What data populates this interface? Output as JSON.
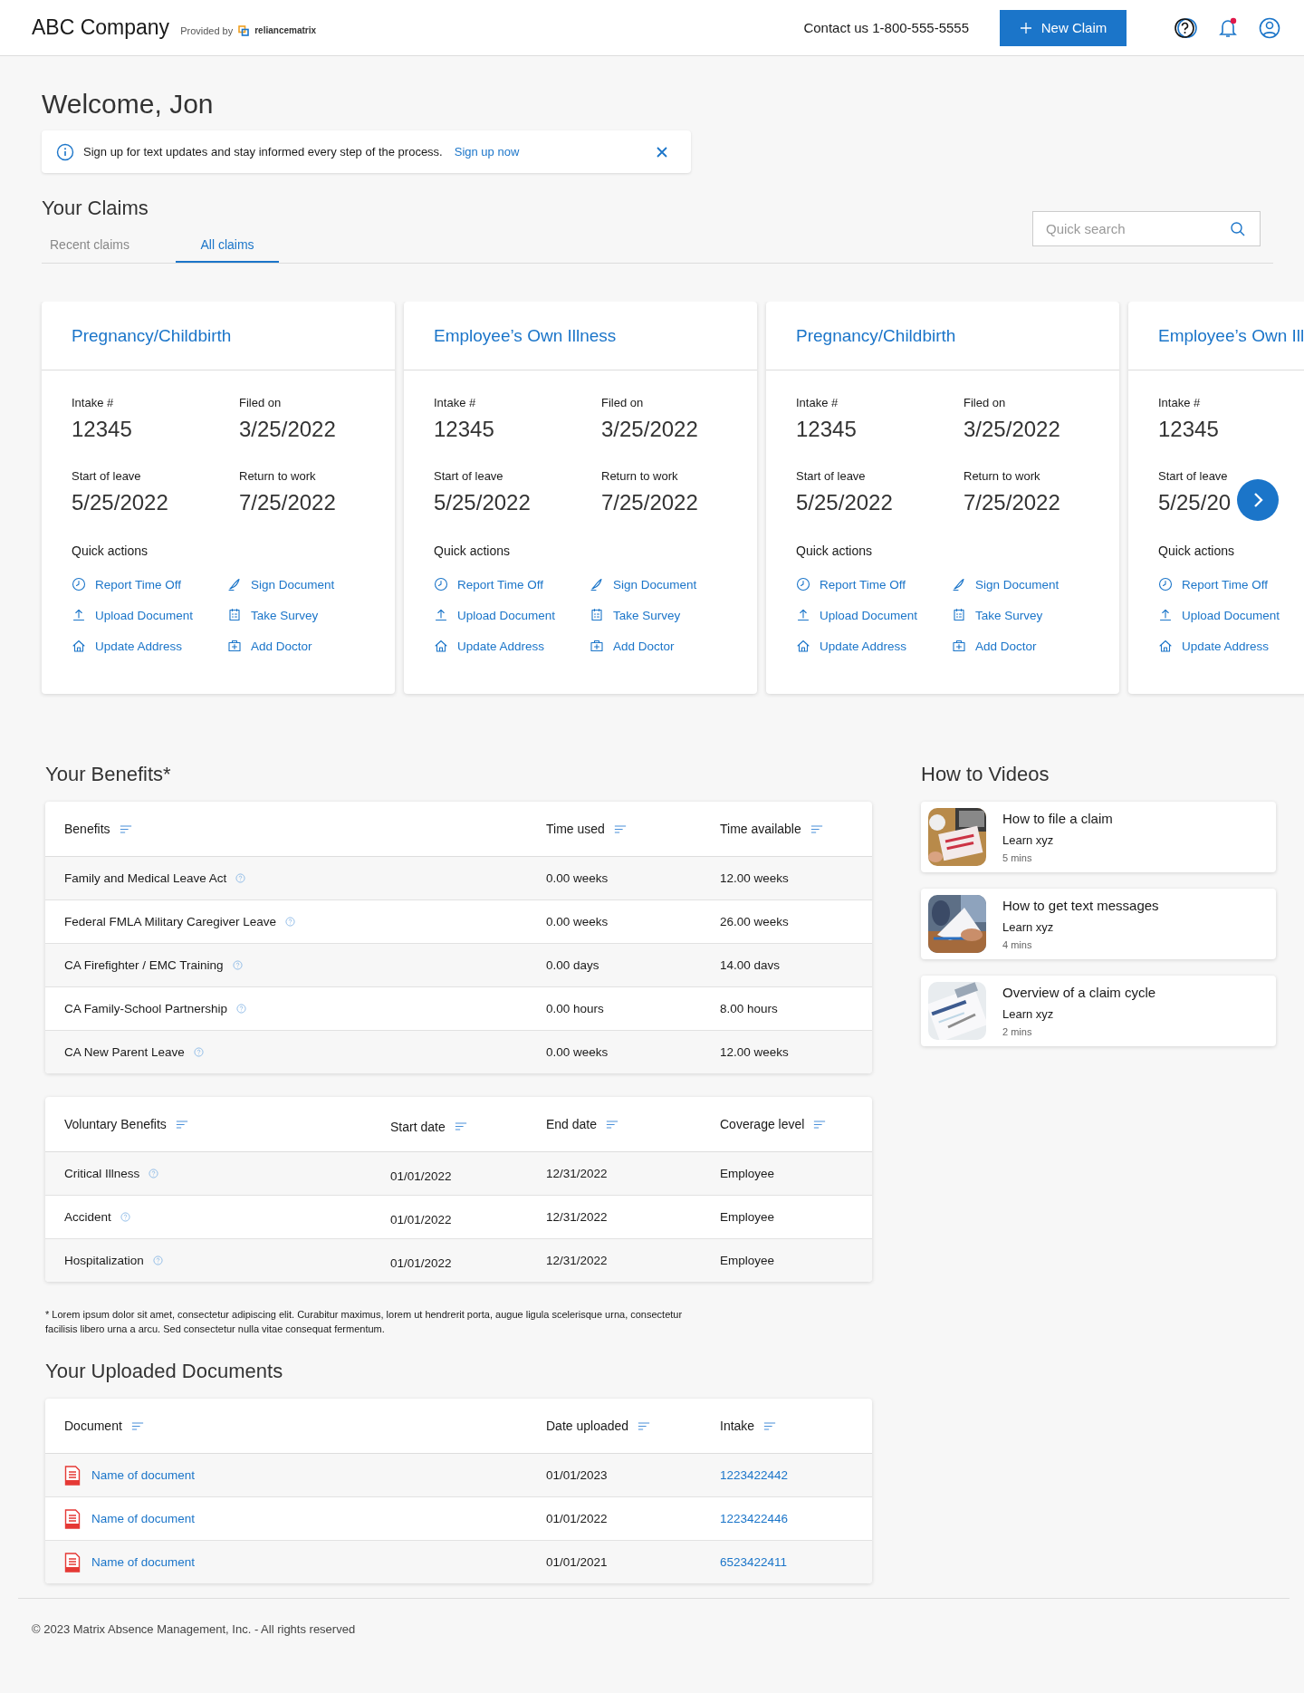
{
  "header": {
    "company": "ABC Company",
    "provided_by": "Provided by",
    "partner_logo": "reliancematrix",
    "contact": "Contact us 1-800-555-5555",
    "new_claim": "New Claim"
  },
  "welcome": "Welcome, Jon",
  "banner": {
    "text": "Sign up for text updates and stay informed every step of the process.",
    "link": "Sign up now"
  },
  "claims": {
    "title": "Your Claims",
    "tabs": [
      {
        "label": "Recent claims",
        "selected": false
      },
      {
        "label": "All claims",
        "selected": true
      }
    ],
    "search": {
      "placeholder": "Quick search"
    },
    "cards": [
      {
        "title": "Pregnancy/Childbirth",
        "fields": [
          {
            "label": "Intake #",
            "value": "12345"
          },
          {
            "label": "Start of leave",
            "value": "5/25/2022"
          },
          {
            "label": "Filed on",
            "value": "3/25/2022"
          },
          {
            "label": "Return to work",
            "value": "7/25/2022"
          }
        ],
        "actions_label": "Quick actions",
        "actions": [
          {
            "kind": "report",
            "label": "Report Time Off"
          },
          {
            "kind": "upload",
            "label": "Upload Document"
          },
          {
            "kind": "address",
            "label": "Update Address"
          },
          {
            "kind": "sign",
            "label": "Sign Document"
          },
          {
            "kind": "survey",
            "label": "Take Survey"
          },
          {
            "kind": "doctor",
            "label": "Add Doctor"
          }
        ]
      },
      {
        "title": "Employee’s Own Illness",
        "fields": [
          {
            "label": "Intake #",
            "value": "12345"
          },
          {
            "label": "Start of leave",
            "value": "5/25/2022"
          },
          {
            "label": "Filed on",
            "value": "3/25/2022"
          },
          {
            "label": "Return to work",
            "value": "7/25/2022"
          }
        ],
        "actions_label": "Quick actions",
        "actions": [
          {
            "kind": "report",
            "label": "Report Time Off"
          },
          {
            "kind": "upload",
            "label": "Upload Document"
          },
          {
            "kind": "address",
            "label": "Update Address"
          },
          {
            "kind": "sign",
            "label": "Sign Document"
          },
          {
            "kind": "survey",
            "label": "Take Survey"
          },
          {
            "kind": "doctor",
            "label": "Add Doctor"
          }
        ]
      },
      {
        "title": "Pregnancy/Childbirth",
        "fields": [
          {
            "label": "Intake #",
            "value": "12345"
          },
          {
            "label": "Start of leave",
            "value": "5/25/2022"
          },
          {
            "label": "Filed on",
            "value": "3/25/2022"
          },
          {
            "label": "Return to work",
            "value": "7/25/2022"
          }
        ],
        "actions_label": "Quick actions",
        "actions": [
          {
            "kind": "report",
            "label": "Report Time Off"
          },
          {
            "kind": "upload",
            "label": "Upload Document"
          },
          {
            "kind": "address",
            "label": "Update Address"
          },
          {
            "kind": "sign",
            "label": "Sign Document"
          },
          {
            "kind": "survey",
            "label": "Take Survey"
          },
          {
            "kind": "doctor",
            "label": "Add Doctor"
          }
        ]
      },
      {
        "title": "Employee’s Own Ill",
        "fields": [
          {
            "label": "Intake #",
            "value": "12345"
          },
          {
            "label": "Start of leave",
            "value": "5/25/20"
          }
        ],
        "actions_label": "Quick actions",
        "actions": [
          {
            "kind": "report",
            "label": "Report Time Off"
          },
          {
            "kind": "upload",
            "label": "Upload Document"
          },
          {
            "kind": "address",
            "label": "Update Address"
          }
        ]
      }
    ]
  },
  "benefits": {
    "title": "Your Benefits*",
    "table": {
      "columns": [
        "Benefits",
        "Time used",
        "Time available"
      ],
      "rows": [
        [
          "Family and Medical Leave Act",
          "0.00 weeks",
          "12.00 weeks"
        ],
        [
          "Federal FMLA Military Caregiver Leave",
          "0.00 weeks",
          "26.00 weeks"
        ],
        [
          "CA Firefighter / EMC Training",
          "0.00 days",
          "14.00 davs"
        ],
        [
          "CA Family-School Partnership",
          "0.00 hours",
          "8.00 hours"
        ],
        [
          "CA New Parent Leave",
          "0.00 weeks",
          "12.00 weeks"
        ]
      ]
    },
    "voluntary": {
      "columns": [
        "Voluntary Benefits",
        "Start date",
        "End date",
        "Coverage level"
      ],
      "rows": [
        [
          "Critical Illness",
          "01/01/2022",
          "12/31/2022",
          "Employee"
        ],
        [
          "Accident",
          "01/01/2022",
          "12/31/2022",
          "Employee"
        ],
        [
          "Hospitalization",
          "01/01/2022",
          "12/31/2022",
          "Employee"
        ]
      ]
    },
    "footnote": "* Lorem ipsum dolor sit amet, consectetur adipiscing elit. Curabitur maximus, lorem ut hendrerit porta, augue ligula scelerisque urna, consectetur facilisis libero urna a arcu. Sed consectetur nulla vitae consequat fermentum."
  },
  "videos": {
    "title": "How to Videos",
    "items": [
      {
        "title": "How to file a claim",
        "subtitle": "Learn xyz",
        "duration": "5 mins"
      },
      {
        "title": "How to get text messages",
        "subtitle": "Learn xyz",
        "duration": "4 mins"
      },
      {
        "title": "Overview of a claim cycle",
        "subtitle": "Learn xyz",
        "duration": "2 mins"
      }
    ]
  },
  "documents": {
    "title": "Your Uploaded Documents",
    "columns": [
      "Document",
      "Date uploaded",
      "Intake"
    ],
    "rows": [
      {
        "name": "Name of document",
        "date": "01/01/2023",
        "intake": "1223422442"
      },
      {
        "name": "Name of document",
        "date": "01/01/2022",
        "intake": "1223422446"
      },
      {
        "name": "Name of document",
        "date": "01/01/2021",
        "intake": "6523422411"
      }
    ]
  },
  "footer": "© 2023 Matrix Absence Management, Inc. - All rights reserved"
}
